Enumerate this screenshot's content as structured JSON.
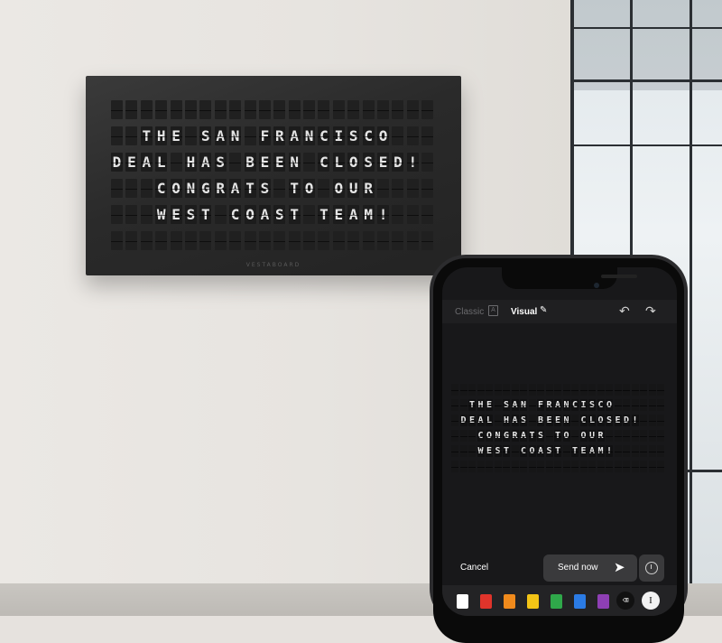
{
  "wall_board": {
    "brand": "VESTABOARD",
    "rows": [
      "                         ",
      "  THE SAN FRANCISCO     ",
      "DEAL HAS BEEN CLOSED!   ",
      "   CONGRATS TO OUR      ",
      "   WEST COAST TEAM!     ",
      "                         "
    ]
  },
  "app": {
    "mode_classic": "Classic",
    "mode_classic_icon": "A",
    "mode_visual": "Visual",
    "pen_icon": "pen-icon",
    "undo_icon": "undo-icon",
    "redo_icon": "redo-icon",
    "preview_rows": [
      "                         ",
      "  THE SAN FRANCISCO      ",
      " DEAL HAS BEEN CLOSED!   ",
      "   CONGRATS TO OUR       ",
      "   WEST COAST TEAM!      ",
      "                         "
    ],
    "cancel_label": "Cancel",
    "send_label": "Send now",
    "send_icon": "paper-plane-icon",
    "schedule_icon": "clock-icon",
    "palette": [
      "#ffffff",
      "#e0342b",
      "#f08a1c",
      "#f3c416",
      "#2fa84a",
      "#2b7be4",
      "#8e3fb4"
    ],
    "eraser_icon": "eraser-icon",
    "text_cursor_icon": "text-cursor-icon"
  }
}
